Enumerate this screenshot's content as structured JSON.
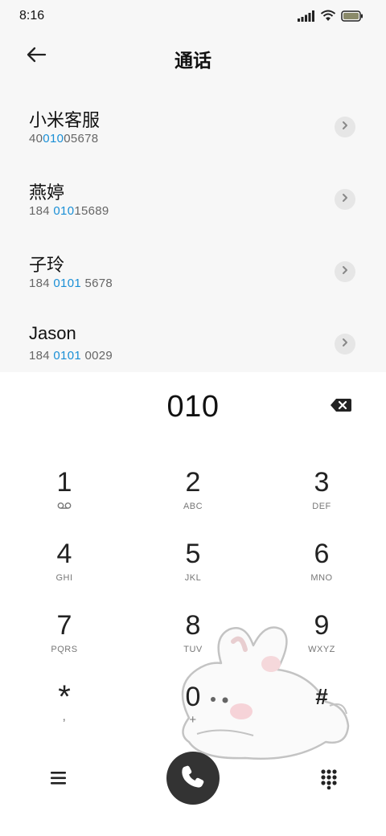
{
  "status_bar": {
    "time": "8:16",
    "icons": [
      "signal-icon",
      "wifi-icon",
      "battery-icon"
    ]
  },
  "header": {
    "back_icon": "arrow-left-icon",
    "title": "通话"
  },
  "contacts": [
    {
      "name": "小米客服",
      "number_pre": "40",
      "number_hl": "010",
      "number_post": "05678"
    },
    {
      "name": "燕婷",
      "number_pre": "184 ",
      "number_hl": "010",
      "number_post": "15689"
    },
    {
      "name": "子玲",
      "number_pre": "184 ",
      "number_hl": "0101",
      "number_post": " 5678"
    },
    {
      "name": "Jason",
      "number_pre": "184 ",
      "number_hl": "0101",
      "number_post": " 0029"
    }
  ],
  "dialpad": {
    "entered_number": "010",
    "keys": [
      {
        "digit": "1",
        "letters": ""
      },
      {
        "digit": "2",
        "letters": "ABC"
      },
      {
        "digit": "3",
        "letters": "DEF"
      },
      {
        "digit": "4",
        "letters": "GHI"
      },
      {
        "digit": "5",
        "letters": "JKL"
      },
      {
        "digit": "6",
        "letters": "MNO"
      },
      {
        "digit": "7",
        "letters": "PQRS"
      },
      {
        "digit": "8",
        "letters": "TUV"
      },
      {
        "digit": "9",
        "letters": "WXYZ"
      },
      {
        "digit": "*",
        "letters": ","
      },
      {
        "digit": "0",
        "letters": "+"
      },
      {
        "digit": "#",
        "letters": ""
      }
    ]
  },
  "colors": {
    "highlight": "#1a8fd6",
    "call_button": "#333333",
    "list_background": "#f7f7f7"
  }
}
